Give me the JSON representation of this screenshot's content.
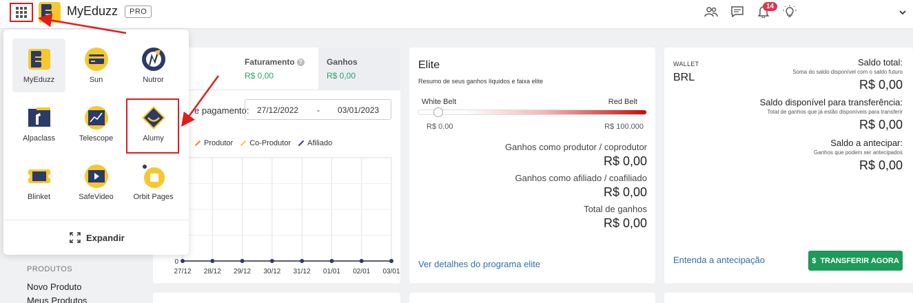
{
  "header": {
    "brand": "MyEduzz",
    "badge": "PRO",
    "notifications_count": "14"
  },
  "card_ganhos": {
    "tab_faturamento": {
      "title": "Faturamento",
      "value": "R$ 0,00"
    },
    "tab_ganhos": {
      "title": "Ganhos",
      "value": "R$ 0,00"
    },
    "date_label": "e pagamento:",
    "date_from": "27/12/2022",
    "date_sep": "-",
    "date_to": "03/01/2023",
    "legend": [
      {
        "label": "Produtor",
        "color": "#f07f2a"
      },
      {
        "label": "Co-Produtor",
        "color": "#f4c430"
      },
      {
        "label": "Afiliado",
        "color": "#2b3a67"
      }
    ]
  },
  "chart_data": {
    "type": "line",
    "categories": [
      "27/12",
      "28/12",
      "29/12",
      "30/12",
      "31/12",
      "01/01",
      "02/01",
      "03/01"
    ],
    "series": [
      {
        "name": "Produtor",
        "values": [
          0,
          0,
          0,
          0,
          0,
          0,
          0,
          0
        ]
      },
      {
        "name": "Co-Produtor",
        "values": [
          0,
          0,
          0,
          0,
          0,
          0,
          0,
          0
        ]
      },
      {
        "name": "Afiliado",
        "values": [
          0,
          0,
          0,
          0,
          0,
          0,
          0,
          0
        ]
      }
    ],
    "y_tick": "0",
    "grid": true
  },
  "elite": {
    "title": "Elite",
    "subtitle": "Resumo de seus ganhos líquidos e faixa elite",
    "belt_left": "White Belt",
    "belt_right": "Red Belt",
    "belt_min": "R$ 0.00",
    "belt_max": "R$ 100.000",
    "progress": 0,
    "rows": [
      {
        "label": "Ganhos como produtor / coprodutor",
        "value": "R$ 0,00"
      },
      {
        "label": "Ganhos como afiliado / coafiliado",
        "value": "R$ 0,00"
      },
      {
        "label": "Total de ganhos",
        "value": "R$ 0,00"
      }
    ],
    "link": "Ver detalhes do programa elite"
  },
  "wallet": {
    "label": "WALLET",
    "currency": "BRL",
    "total": {
      "title": "Saldo total:",
      "sub": "Soma do saldo disponível com o saldo futuro",
      "value": "R$ 0,00"
    },
    "available": {
      "title": "Saldo disponível para transferência:",
      "sub": "Total de ganhos que já estão disponíveis para transferir",
      "value": "R$ 0,00"
    },
    "advance": {
      "title": "Saldo a antecipar:",
      "sub": "Ganhos que podem ser antecipados",
      "value": "R$ 0,00"
    },
    "link": "Entenda a antecipação",
    "button": "TRANSFERIR AGORA",
    "button_symbol": "$"
  },
  "sidebar": {
    "section": "PRODUTOS",
    "items": [
      "Novo Produto",
      "Meus Produtos"
    ]
  },
  "launcher": {
    "apps": [
      {
        "label": "MyEduzz",
        "icon": "myeduzz-icon"
      },
      {
        "label": "Sun",
        "icon": "sun-card-icon"
      },
      {
        "label": "Nutror",
        "icon": "nutror-icon"
      },
      {
        "label": "Alpaclass",
        "icon": "alpaclass-icon"
      },
      {
        "label": "Telescope",
        "icon": "telescope-icon"
      },
      {
        "label": "Alumy",
        "icon": "alumy-icon"
      },
      {
        "label": "Blinket",
        "icon": "blinket-icon"
      },
      {
        "label": "SafeVideo",
        "icon": "safevideo-icon"
      },
      {
        "label": "Orbit Pages",
        "icon": "orbit-pages-icon"
      }
    ],
    "expand": "Expandir"
  }
}
